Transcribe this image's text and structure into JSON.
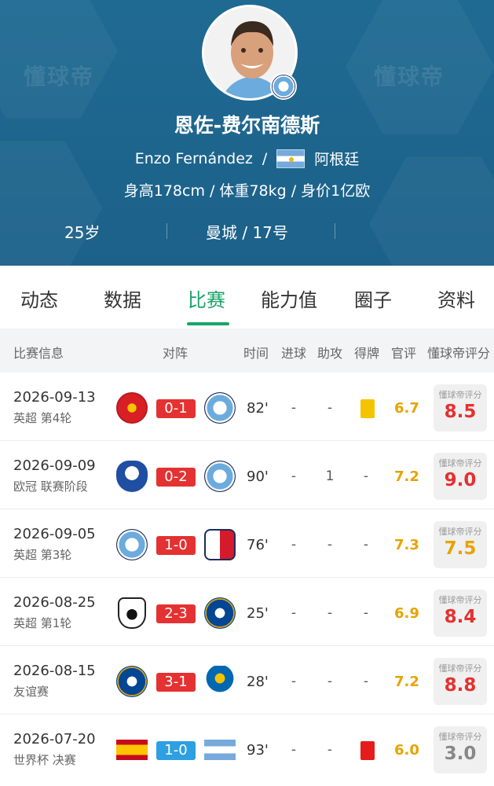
{
  "watermark": "懂球帝",
  "player": {
    "name_cn": "恩佐-费尔南德斯",
    "name_en": "Enzo Fernández",
    "separator": "/",
    "nationality": "阿根廷",
    "physical": "身高178cm / 体重78kg / 身价1亿欧",
    "age": "25岁",
    "club_number": "曼城 / 17号"
  },
  "tabs": [
    "动态",
    "数据",
    "比赛",
    "能力值",
    "圈子",
    "资料"
  ],
  "active_tab": "比赛",
  "table": {
    "headers": [
      "比赛信息",
      "对阵",
      "时间",
      "进球",
      "助攻",
      "得牌",
      "官评",
      "懂球帝评分"
    ],
    "rating_label": "懂球帝评分",
    "rows": [
      {
        "date": "2026-09-13",
        "competition": "英超 第4轮",
        "home": "manchester-united-crest",
        "away": "manchester-city-crest",
        "score": "0-1",
        "score_color": "red",
        "minutes": "82'",
        "goals": "-",
        "assists": "-",
        "card": "yellow",
        "official": "6.7",
        "rating": "8.5"
      },
      {
        "date": "2026-09-09",
        "competition": "欧冠 联赛阶段",
        "home": "porto-crest",
        "away": "manchester-city-crest",
        "score": "0-2",
        "score_color": "red",
        "minutes": "90'",
        "goals": "-",
        "assists": "1",
        "card": "-",
        "official": "7.2",
        "rating": "9.0"
      },
      {
        "date": "2026-09-05",
        "competition": "英超 第3轮",
        "home": "manchester-city-crest",
        "away": "coventry-crest",
        "score": "1-0",
        "score_color": "red",
        "minutes": "76'",
        "goals": "-",
        "assists": "-",
        "card": "-",
        "official": "7.3",
        "rating": "7.5"
      },
      {
        "date": "2026-08-25",
        "competition": "英超 第1轮",
        "home": "fulham-crest",
        "away": "chelsea-crest",
        "score": "2-3",
        "score_color": "red",
        "minutes": "25'",
        "goals": "-",
        "assists": "-",
        "card": "-",
        "official": "6.9",
        "rating": "8.4"
      },
      {
        "date": "2026-08-15",
        "competition": "友谊赛",
        "home": "chelsea-crest",
        "away": "real-sociedad-crest",
        "score": "3-1",
        "score_color": "red",
        "minutes": "28'",
        "goals": "-",
        "assists": "-",
        "card": "-",
        "official": "7.2",
        "rating": "8.8"
      },
      {
        "date": "2026-07-20",
        "competition": "世界杯 决赛",
        "home": "spain-flag",
        "away": "argentina-flag",
        "score": "1-0",
        "score_color": "blue",
        "minutes": "93'",
        "goals": "-",
        "assists": "-",
        "card": "red",
        "official": "6.0",
        "rating": "3.0"
      }
    ]
  },
  "colors": {
    "header_bg": "#1f6a93",
    "accent_green": "#1aa36a",
    "score_red": "#e43131",
    "score_blue": "#2e9fe0",
    "official_yellow": "#e6a400"
  }
}
